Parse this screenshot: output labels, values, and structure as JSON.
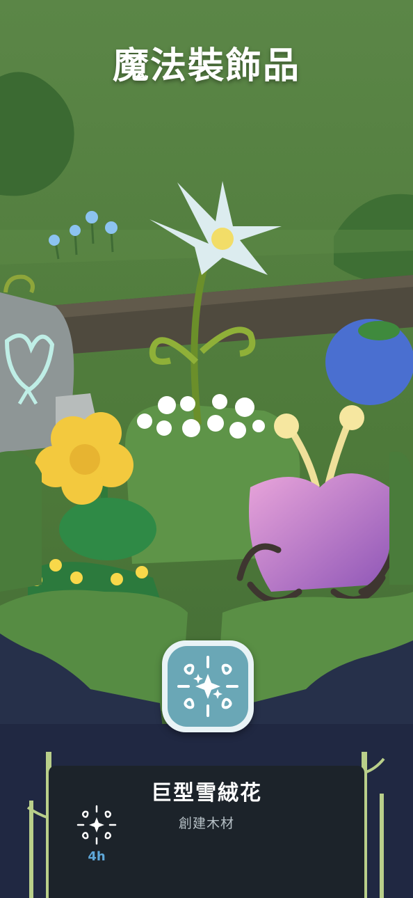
{
  "page": {
    "title": "魔法裝飾品"
  },
  "item": {
    "name": "巨型雪絨花",
    "subtitle": "創建木材",
    "time": "4h",
    "icon": "magic-sparkle-icon"
  },
  "colors": {
    "background": "#4f7a3c",
    "panel": "#1c232a",
    "badge": "#6aa7b6",
    "time_accent": "#5ea7d8"
  }
}
